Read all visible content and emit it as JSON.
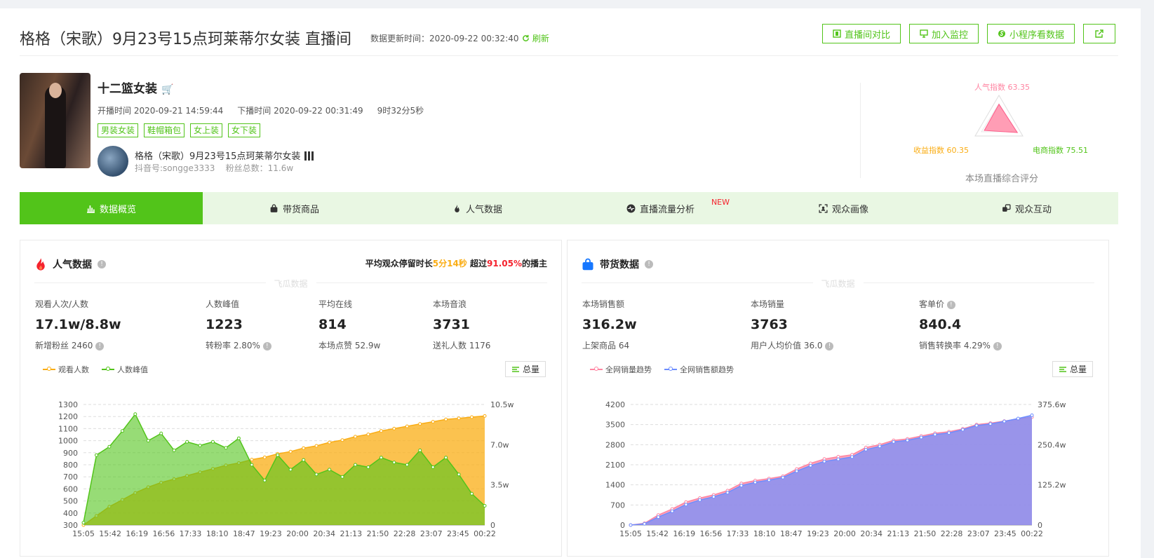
{
  "header": {
    "title": "格格（宋歌）9月23号15点珂莱蒂尔女装  直播间",
    "update_label": "数据更新时间：",
    "update_time": "2020-09-22 00:32:40",
    "refresh": "刷新",
    "buttons": [
      {
        "label": "直播间对比",
        "icon": "compare-icon"
      },
      {
        "label": "加入监控",
        "icon": "monitor-icon"
      },
      {
        "label": "小程序看数据",
        "icon": "miniapp-icon"
      },
      {
        "label": "",
        "icon": "share-icon"
      }
    ]
  },
  "room": {
    "shop_name": "十二篮女装",
    "start_label": "开播时间",
    "start_time": "2020-09-21 14:59:44",
    "end_label": "下播时间",
    "end_time": "2020-09-22 00:31:49",
    "duration": "9时32分5秒",
    "tags": [
      "男装女装",
      "鞋帽箱包",
      "女上装",
      "女下装"
    ],
    "anchor_name": "格格（宋歌）9月23号15点珂莱蒂尔女装",
    "douyin_id": "抖音号:songge3333",
    "fans": "粉丝总数：11.6w"
  },
  "score": {
    "popularity": "人气指数 63.35",
    "revenue": "收益指数 60.35",
    "ecommerce": "电商指数 75.51",
    "caption": "本场直播综合评分",
    "values": {
      "popularity": 63.35,
      "revenue": 60.35,
      "ecommerce": 75.51
    },
    "colors": {
      "popularity": "#ff85a2",
      "revenue": "#faad14",
      "ecommerce": "#52c41a"
    }
  },
  "tabs": [
    {
      "label": "数据概览",
      "icon": "bar-chart-icon",
      "active": true
    },
    {
      "label": "带货商品",
      "icon": "bag-icon"
    },
    {
      "label": "人气数据",
      "icon": "flame-icon"
    },
    {
      "label": "直播流量分析",
      "icon": "pulse-icon",
      "badge": "NEW"
    },
    {
      "label": "观众画像",
      "icon": "portrait-icon"
    },
    {
      "label": "观众互动",
      "icon": "interaction-icon"
    }
  ],
  "popularity_card": {
    "title": "人气数据",
    "dwell_prefix": "平均观众停留时长",
    "dwell_time": "5分14秒",
    "dwell_mid": " 超过",
    "dwell_pct": "91.05%",
    "dwell_suffix": "的播主",
    "watermark": "飞瓜数据",
    "metrics": [
      {
        "label": "观看人次/人数",
        "value": "17.1w/8.8w",
        "sub": "新增粉丝 2460"
      },
      {
        "label": "人数峰值",
        "value": "1223",
        "sub": "转粉率 2.80%"
      },
      {
        "label": "平均在线",
        "value": "814",
        "sub": "本场点赞 52.9w"
      },
      {
        "label": "本场音浪",
        "value": "3731",
        "sub": "送礼人数 1176"
      }
    ],
    "legend": [
      "观看人数",
      "人数峰值"
    ],
    "total_button": "总量"
  },
  "sales_card": {
    "title": "带货数据",
    "watermark": "飞瓜数据",
    "metrics": [
      {
        "label": "本场销售额",
        "value": "316.2w",
        "sub": "上架商品 64"
      },
      {
        "label": "本场销量",
        "value": "3763",
        "sub": "用户人均价值 36.0"
      },
      {
        "label": "客单价",
        "value": "840.4",
        "sub": "销售转换率 4.29%"
      }
    ],
    "legend": [
      "全网销量趋势",
      "全网销售额趋势"
    ],
    "total_button": "总量"
  },
  "chart_data": [
    {
      "type": "area",
      "x": [
        "15:05",
        "15:42",
        "16:19",
        "16:56",
        "17:33",
        "18:10",
        "18:47",
        "19:23",
        "20:00",
        "20:34",
        "21:13",
        "21:50",
        "22:28",
        "23:07",
        "23:45",
        "00:22"
      ],
      "left_ticks": [
        "300",
        "400",
        "500",
        "600",
        "700",
        "800",
        "900",
        "1000",
        "1100",
        "1200",
        "1300"
      ],
      "right_ticks": [
        "0",
        "3.5w",
        "7.0w",
        "10.5w"
      ],
      "ylim": [
        300,
        1300
      ],
      "y2lim": [
        0,
        105000
      ],
      "series": [
        {
          "name": "观看人数",
          "axis": "right",
          "color": "#faad14",
          "values": [
            0,
            8000,
            16000,
            22000,
            28000,
            33000,
            37000,
            40000,
            43000,
            46000,
            49000,
            52000,
            54000,
            57000,
            59000,
            62000,
            64000,
            67000,
            69000,
            72000,
            74000,
            77000,
            79000,
            82000,
            84000,
            86000,
            88000,
            90000,
            92000,
            93000,
            94000,
            95000
          ]
        },
        {
          "name": "人数峰值",
          "axis": "left",
          "color": "#52c41a",
          "values": [
            320,
            880,
            950,
            1080,
            1220,
            1000,
            1060,
            920,
            990,
            960,
            990,
            940,
            1020,
            800,
            670,
            880,
            760,
            840,
            720,
            760,
            700,
            800,
            780,
            860,
            820,
            800,
            920,
            780,
            860,
            720,
            560,
            460
          ]
        }
      ]
    },
    {
      "type": "area",
      "x": [
        "15:05",
        "15:42",
        "16:19",
        "16:56",
        "17:33",
        "18:10",
        "18:47",
        "19:23",
        "20:00",
        "20:34",
        "21:13",
        "21:50",
        "22:28",
        "23:07",
        "23:45",
        "00:22"
      ],
      "left_ticks": [
        "0",
        "700",
        "1400",
        "2100",
        "2800",
        "3500",
        "4200"
      ],
      "right_ticks": [
        "0",
        "125.2w",
        "250.4w",
        "375.6w"
      ],
      "ylim": [
        0,
        4200
      ],
      "y2lim": [
        0,
        3756000
      ],
      "series": [
        {
          "name": "全网销量趋势",
          "axis": "left",
          "color": "#ff85a2",
          "values": [
            0,
            60,
            350,
            560,
            800,
            940,
            1050,
            1200,
            1450,
            1550,
            1620,
            1700,
            1950,
            2150,
            2300,
            2380,
            2450,
            2700,
            2800,
            2950,
            3000,
            3100,
            3200,
            3250,
            3350,
            3500,
            3550,
            3620,
            3700,
            3760
          ]
        },
        {
          "name": "全网销售额趋势",
          "axis": "right",
          "color": "#6d8dff",
          "values": [
            0,
            40000,
            250000,
            430000,
            640000,
            780000,
            880000,
            1010000,
            1230000,
            1330000,
            1400000,
            1480000,
            1680000,
            1850000,
            1980000,
            2050000,
            2120000,
            2350000,
            2450000,
            2590000,
            2640000,
            2730000,
            2820000,
            2870000,
            2970000,
            3100000,
            3150000,
            3230000,
            3320000,
            3420000
          ]
        }
      ]
    }
  ]
}
